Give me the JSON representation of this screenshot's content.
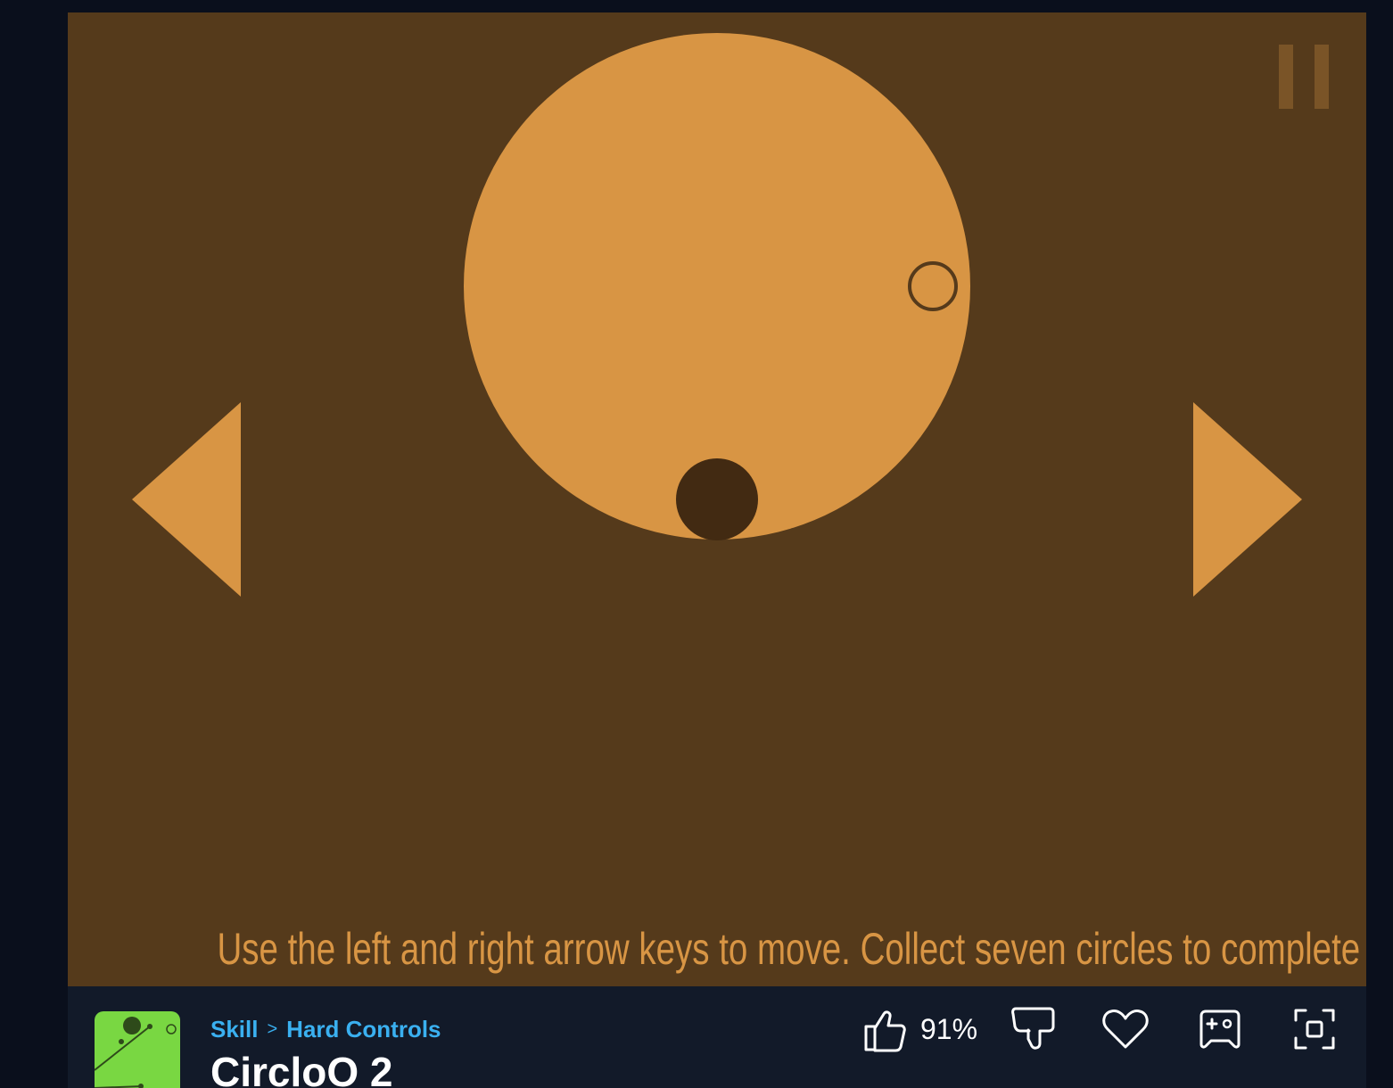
{
  "game": {
    "instructions": "Use the left and right arrow keys to move. Collect seven circles to complete the level.",
    "colors": {
      "background": "#553a1b",
      "accent": "#d89544",
      "dark": "#422a12",
      "pause": "#7a5427"
    },
    "controls": {
      "pause_icon": "pause-icon",
      "left_icon": "left-arrow-icon",
      "right_icon": "right-arrow-icon"
    }
  },
  "info": {
    "category": "Skill",
    "separator": ">",
    "subcategory": "Hard Controls",
    "title": "CircloO 2",
    "rating": "91%",
    "icons": {
      "like": "thumbs-up-icon",
      "dislike": "thumbs-down-icon",
      "favorite": "heart-icon",
      "add_to_playlist": "gamepad-add-icon",
      "fullscreen": "fullscreen-icon"
    }
  }
}
